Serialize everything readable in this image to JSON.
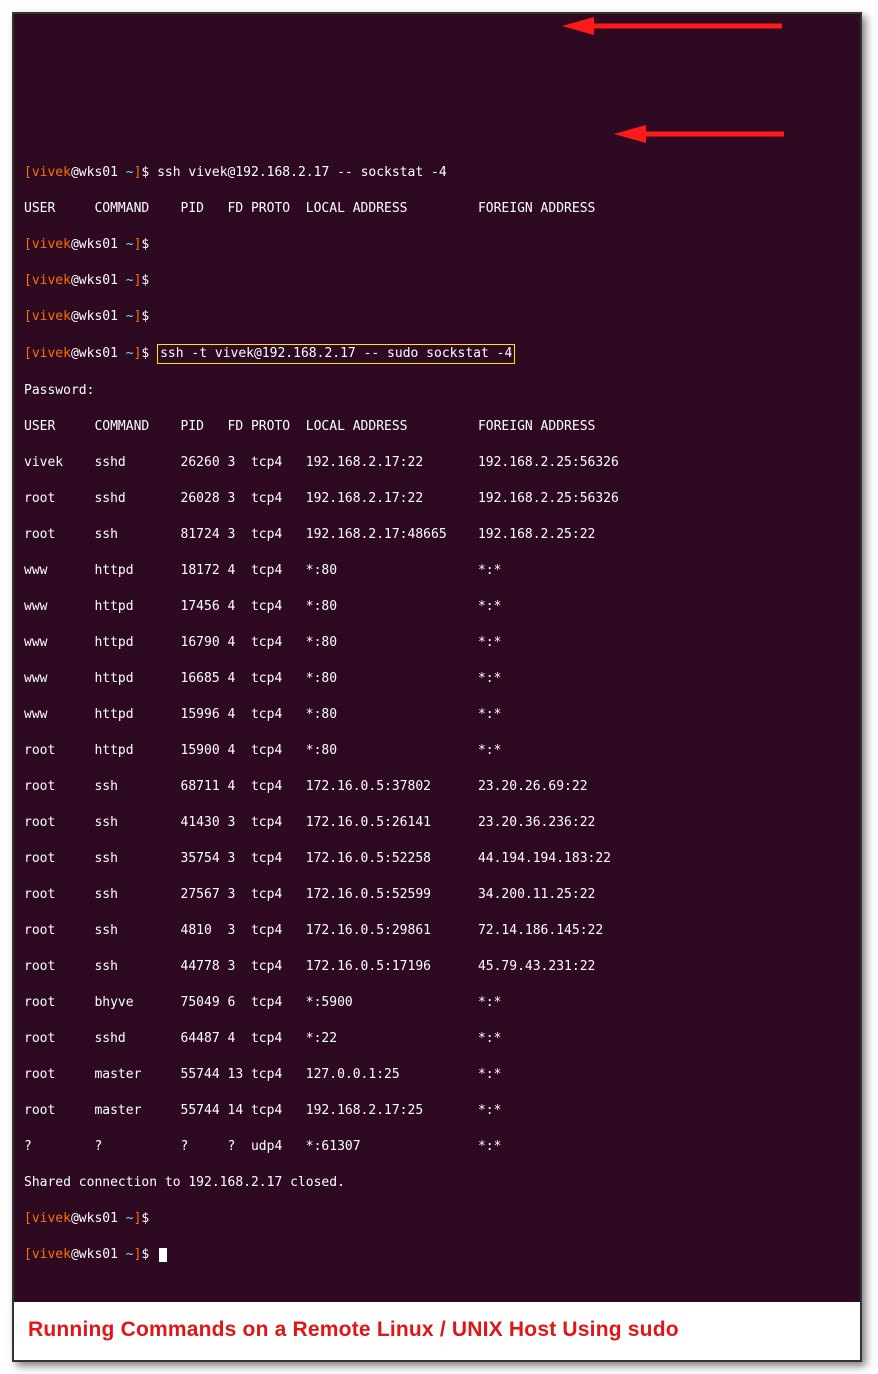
{
  "prompt": {
    "user": "vivek",
    "host": "wks01",
    "dir": "~"
  },
  "cmd1": "ssh vivek@192.168.2.17 -- sockstat -4",
  "header1": "USER     COMMAND    PID   FD PROTO  LOCAL ADDRESS         FOREIGN ADDRESS",
  "cmd2": "ssh -t vivek@192.168.2.17 -- sudo sockstat -4",
  "pwprompt": "Password:",
  "header2": "USER     COMMAND    PID   FD PROTO  LOCAL ADDRESS         FOREIGN ADDRESS",
  "rows": [
    "vivek    sshd       26260 3  tcp4   192.168.2.17:22       192.168.2.25:56326",
    "root     sshd       26028 3  tcp4   192.168.2.17:22       192.168.2.25:56326",
    "root     ssh        81724 3  tcp4   192.168.2.17:48665    192.168.2.25:22",
    "www      httpd      18172 4  tcp4   *:80                  *:*",
    "www      httpd      17456 4  tcp4   *:80                  *:*",
    "www      httpd      16790 4  tcp4   *:80                  *:*",
    "www      httpd      16685 4  tcp4   *:80                  *:*",
    "www      httpd      15996 4  tcp4   *:80                  *:*",
    "root     httpd      15900 4  tcp4   *:80                  *:*",
    "root     ssh        68711 4  tcp4   172.16.0.5:37802      23.20.26.69:22",
    "root     ssh        41430 3  tcp4   172.16.0.5:26141      23.20.36.236:22",
    "root     ssh        35754 3  tcp4   172.16.0.5:52258      44.194.194.183:22",
    "root     ssh        27567 3  tcp4   172.16.0.5:52599      34.200.11.25:22",
    "root     ssh        4810  3  tcp4   172.16.0.5:29861      72.14.186.145:22",
    "root     ssh        44778 3  tcp4   172.16.0.5:17196      45.79.43.231:22",
    "root     bhyve      75049 6  tcp4   *:5900                *:*",
    "root     sshd       64487 4  tcp4   *:22                  *:*",
    "root     master     55744 13 tcp4   127.0.0.1:25          *:*",
    "root     master     55744 14 tcp4   192.168.2.17:25       *:*",
    "?        ?          ?     ?  udp4   *:61307               *:*"
  ],
  "closed": "Shared connection to 192.168.2.17 closed.",
  "caption": "Running Commands on a Remote Linux / UNIX Host Using sudo"
}
